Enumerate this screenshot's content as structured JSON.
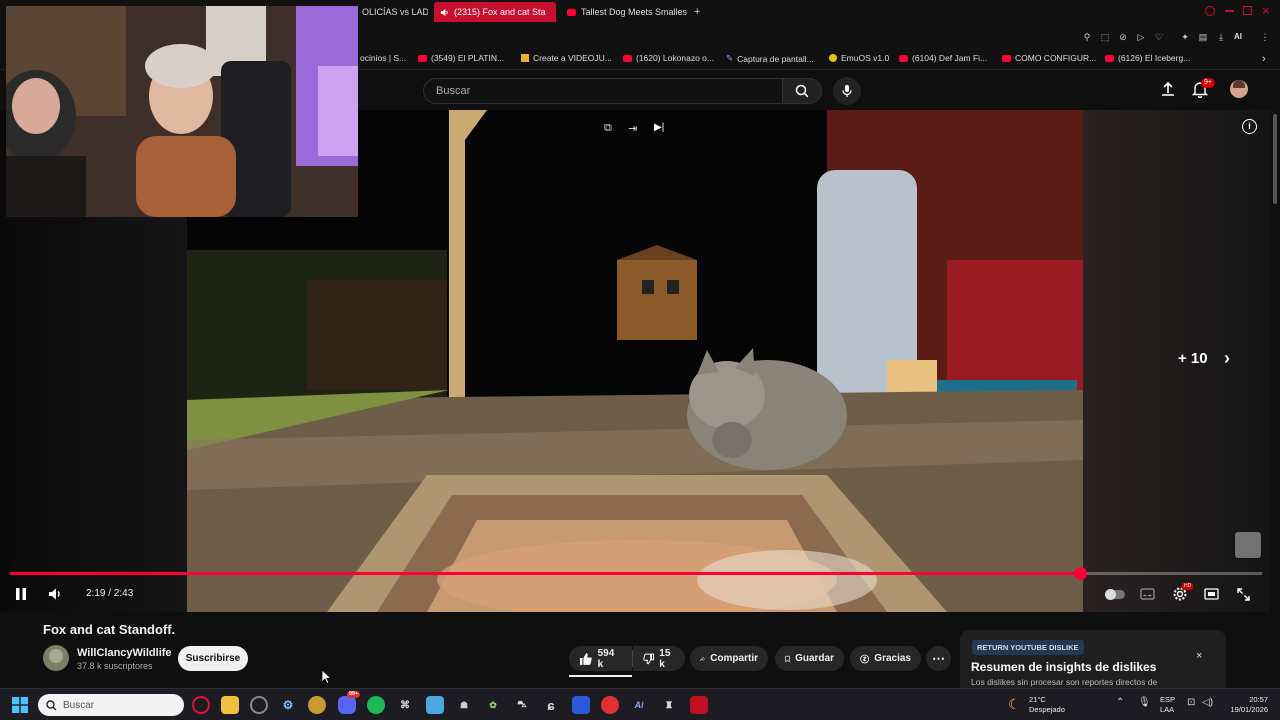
{
  "browser": {
    "tabs": [
      {
        "label": "OLICÍAS vs LADR",
        "active": false
      },
      {
        "label": "(2315) Fox and cat Sta",
        "active": true
      },
      {
        "label": "Tallest Dog Meets Smalles",
        "active": false
      }
    ],
    "new_tab": "+",
    "bookmarks": [
      "ocinios | S...",
      "(3549) El PLATIN...",
      "Create a VIDEOJU...",
      "(1620) Lokonazo o...",
      "Captura de pantall...",
      "EmuOS v1.0",
      "(6104) Def Jam Fi...",
      "COMO CONFIGUR...",
      "(6126) El Iceberg..."
    ],
    "ai_label": "AI"
  },
  "header": {
    "search_placeholder": "Buscar",
    "notification_count": "9+"
  },
  "player": {
    "skip_label": "+ 10",
    "time": "2:19 / 2:43",
    "progress": 0.855,
    "settings_badge": "HD"
  },
  "video": {
    "title": "Fox and cat Standoff.",
    "channel": "WillClancyWildlife",
    "subscribers": "37.8 k suscriptores",
    "subscribe_label": "Suscribirse",
    "likes": "594 k",
    "dislikes": "15 k",
    "share_label": "Compartir",
    "save_label": "Guardar",
    "thanks_label": "Gracias"
  },
  "dislike_panel": {
    "badge": "RETURN YOUTUBE DISLIKE",
    "title": "Resumen de insights de dislikes",
    "description": "Los dislikes sin procesar son reportes directos de",
    "close": "×"
  },
  "taskbar": {
    "search_placeholder": "Buscar",
    "weather_temp": "21°C",
    "weather_desc": "Despejado",
    "lang_1": "ESP",
    "lang_2": "LAA",
    "time": "20:57",
    "date": "19/01/2026",
    "discord_badge": "99+"
  },
  "colors": {
    "accent": "#ff0033",
    "background": "#0f0f0f",
    "tab_active": "#c8102e"
  }
}
